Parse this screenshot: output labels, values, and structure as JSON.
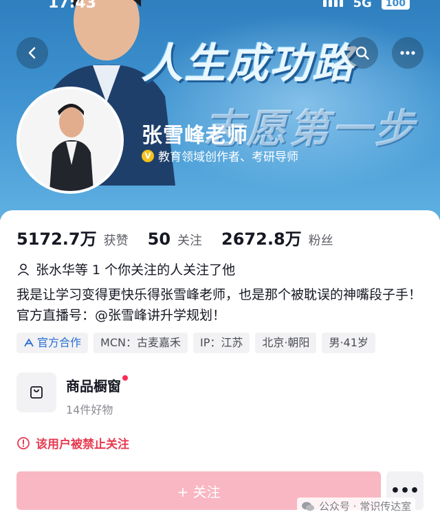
{
  "status_bar": {
    "time": "17:43",
    "network": "5G",
    "battery": "100"
  },
  "banner": {
    "slogan_line1": "人生成功路",
    "slogan_line2": "志愿第一步"
  },
  "profile": {
    "name": "张雪峰老师",
    "verification": "教育领域创作者、考研导师",
    "verify_badge": "V"
  },
  "stats": [
    {
      "value": "5172.7万",
      "label": "获赞"
    },
    {
      "value": "50",
      "label": "关注"
    },
    {
      "value": "2672.8万",
      "label": "粉丝"
    }
  ],
  "mutual_follow": "张水华等 1 个你关注的人关注了他",
  "bio": "我是让学习变得更快乐得张雪峰老师，也是那个被耽误的神嘴段子手！官方直播号：@张雪峰讲升学规划！",
  "tags": [
    "官方合作",
    "MCN：古麦嘉禾",
    "IP：江苏",
    "北京·朝阳",
    "男·41岁"
  ],
  "shop": {
    "title": "商品橱窗",
    "subtitle": "14件好物"
  },
  "banned_notice": "该用户被禁止关注",
  "follow_button": "+ 关注",
  "more_button": "•••",
  "watermark": "公众号 · 常识传达室",
  "colors": {
    "accent": "#fe2c55",
    "follow_disabled": "#f8b7c2",
    "banner": "#3f93d0",
    "official_tag": "#2a6fd6"
  },
  "icons": [
    "back-arrow-icon",
    "search-icon",
    "more-dots-icon",
    "person-icon",
    "shopping-bag-icon",
    "alert-circle-icon",
    "official-cooperation-icon",
    "wechat-icon"
  ]
}
